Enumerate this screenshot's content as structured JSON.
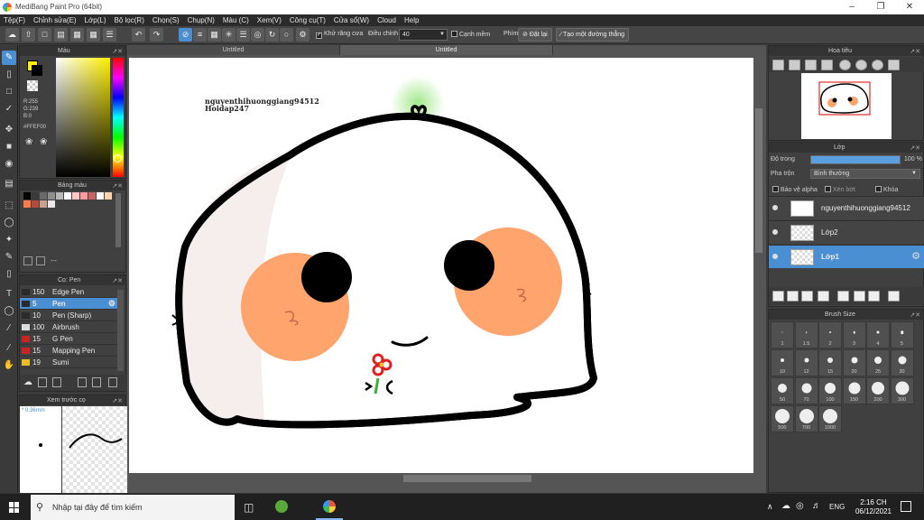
{
  "window": {
    "title": "MediBang Paint Pro (64bit)"
  },
  "menu": [
    "Tệp(F)",
    "Chỉnh sửa(E)",
    "Lớp(L)",
    "Bộ lọc(R)",
    "Chọn(S)",
    "Chụp(N)",
    "Màu (C)",
    "Xem(V)",
    "Công cụ(T)",
    "Cửa sổ(W)",
    "Cloud",
    "Help"
  ],
  "toolbar": {
    "antialias": "Khử răng cưa",
    "adjust": "Điều chỉnh",
    "adjust_value": "40",
    "edge": "Cạnh mềm",
    "pen_label": "Phím",
    "reset": "Đặt lại",
    "straight": "Tạo một đường thẳng"
  },
  "color_panel": {
    "title": "Màu",
    "r": "R:255",
    "g": "G:239",
    "b": "B:0",
    "hex": "#FFEF00",
    "primary": "#FFEF00",
    "secondary": "#000000"
  },
  "palette": {
    "title": "Bảng màu",
    "value": "---",
    "colors": [
      "#000000",
      "#3a3a3a",
      "#6a6a6a",
      "#8e8e8e",
      "#b8b8b8",
      "#ffffff",
      "#ffc8c8",
      "#ff9a9a",
      "#c86464",
      "#ffffff",
      "#ffd4a8",
      "#ff7a4a"
    ]
  },
  "brush_panel": {
    "title": "Cọ: Pen",
    "items": [
      {
        "size": "150",
        "name": "Edge Pen",
        "color": "#2a2a2a"
      },
      {
        "size": "5",
        "name": "Pen",
        "color": "#2a2a2a"
      },
      {
        "size": "10",
        "name": "Pen (Sharp)",
        "color": "#2a2a2a"
      },
      {
        "size": "100",
        "name": "Airbrush",
        "color": "#dddddd"
      },
      {
        "size": "15",
        "name": "G Pen",
        "color": "#cc2222"
      },
      {
        "size": "15",
        "name": "Mapping Pen",
        "color": "#cc2222"
      },
      {
        "size": "19",
        "name": "Sumi",
        "color": "#e8c020"
      }
    ]
  },
  "preview": {
    "title": "Xem trước cọ",
    "size": "0.36mm"
  },
  "tabs": [
    "Untitled",
    "Untitled"
  ],
  "signature": [
    "nguyenthihuonggiang94512",
    "Hoidap247"
  ],
  "navigator": {
    "title": "Hoa tiêu"
  },
  "layers": {
    "title": "Lớp",
    "opacity_label": "Độ trong",
    "opacity_value": "100 %",
    "opacity": 1.0,
    "blend_label": "Pha trộn",
    "blend_value": "Bình thường",
    "protect_alpha": "Bảo vệ alpha",
    "clip": "Xén bớt",
    "lock": "Khóa",
    "items": [
      {
        "name": "nguyenthihuonggiang94512"
      },
      {
        "name": "Lớp2"
      },
      {
        "name": "Lớp1"
      }
    ]
  },
  "brush_size": {
    "title": "Brush Size",
    "sizes": [
      "1",
      "1.5",
      "2",
      "3",
      "4",
      "5",
      "10",
      "12",
      "15",
      "20",
      "25",
      "30",
      "50",
      "70",
      "100",
      "150",
      "200",
      "300",
      "500",
      "700",
      "1000"
    ]
  },
  "taskbar": {
    "search_placeholder": "Nhập tại đây để tìm kiếm",
    "lang": "ENG",
    "time": "2:16 CH",
    "date": "06/12/2021"
  }
}
